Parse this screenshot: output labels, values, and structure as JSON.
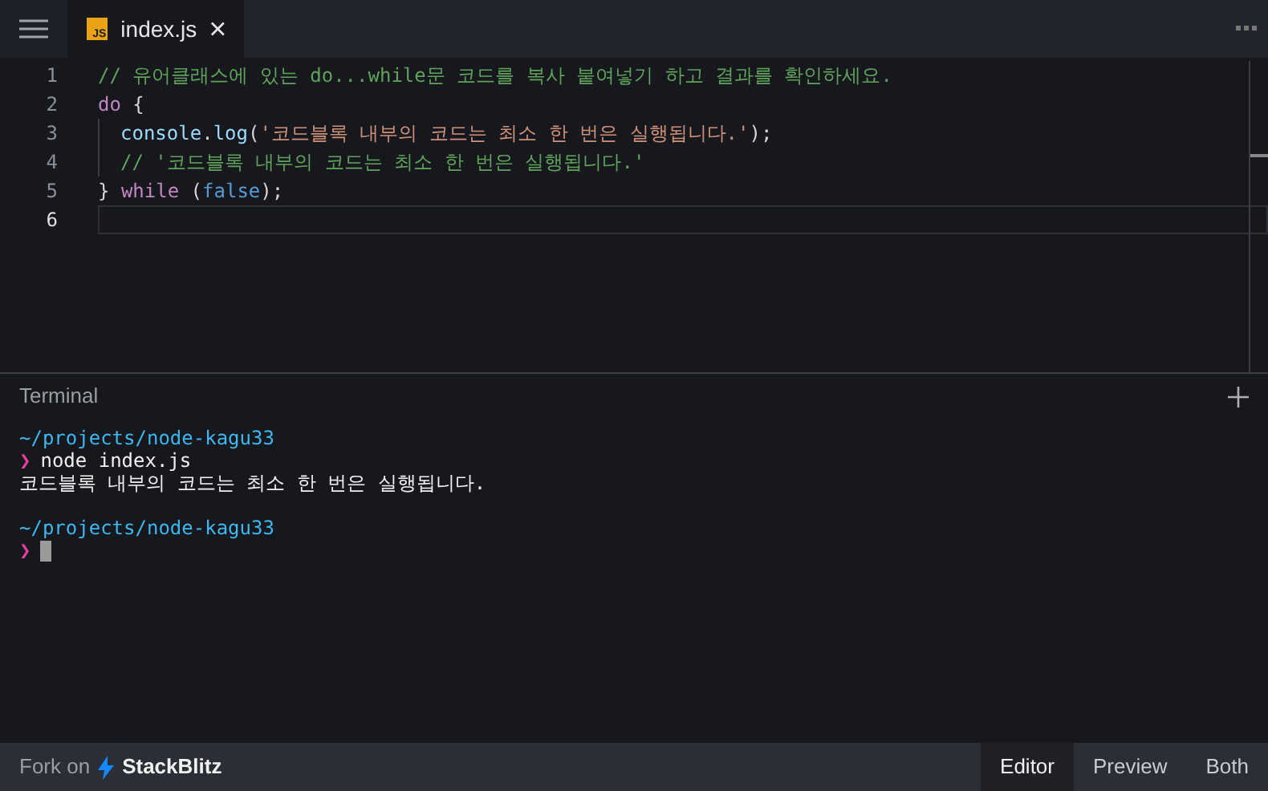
{
  "tab": {
    "icon_text": "JS",
    "label": "index.js",
    "selected": true
  },
  "editor": {
    "lines": [
      {
        "number": "1",
        "indent": false,
        "current": false,
        "tokens": [
          {
            "kind": "comment",
            "text": "// 유어클래스에 있는 do...while문 코드를 복사 붙여넣기 하고 결과를 확인하세요."
          }
        ]
      },
      {
        "number": "2",
        "indent": false,
        "current": false,
        "tokens": [
          {
            "kind": "keyword",
            "text": "do"
          },
          {
            "kind": "plain",
            "text": " {"
          }
        ]
      },
      {
        "number": "3",
        "indent": true,
        "current": false,
        "tokens": [
          {
            "kind": "func",
            "text": "console"
          },
          {
            "kind": "plain",
            "text": "."
          },
          {
            "kind": "func",
            "text": "log"
          },
          {
            "kind": "plain",
            "text": "("
          },
          {
            "kind": "string",
            "text": "'코드블록 내부의 코드는 최소 한 번은 실행됩니다.'"
          },
          {
            "kind": "plain",
            "text": ");"
          }
        ]
      },
      {
        "number": "4",
        "indent": true,
        "current": false,
        "tokens": [
          {
            "kind": "comment",
            "text": "// '코드블록 내부의 코드는 최소 한 번은 실행됩니다.'"
          }
        ]
      },
      {
        "number": "5",
        "indent": false,
        "current": false,
        "tokens": [
          {
            "kind": "plain",
            "text": "} "
          },
          {
            "kind": "keyword",
            "text": "while"
          },
          {
            "kind": "plain",
            "text": " ("
          },
          {
            "kind": "bool",
            "text": "false"
          },
          {
            "kind": "plain",
            "text": ");"
          }
        ]
      },
      {
        "number": "6",
        "indent": false,
        "current": true
      }
    ]
  },
  "terminal": {
    "title": "Terminal",
    "lines": [
      {
        "kind": "path",
        "text": "~/projects/node-kagu33"
      },
      {
        "kind": "command",
        "prompt": "❯",
        "text": "node index.js"
      },
      {
        "kind": "output",
        "text": "코드블록 내부의 코드는 최소 한 번은 실행됩니다."
      },
      {
        "kind": "blank"
      },
      {
        "kind": "path",
        "text": "~/projects/node-kagu33"
      },
      {
        "kind": "cursor",
        "prompt": "❯"
      }
    ]
  },
  "footer": {
    "fork_label": "Fork on",
    "brand": "StackBlitz",
    "views": [
      {
        "label": "Editor",
        "selected": true
      },
      {
        "label": "Preview",
        "selected": false
      },
      {
        "label": "Both",
        "selected": false
      }
    ]
  }
}
